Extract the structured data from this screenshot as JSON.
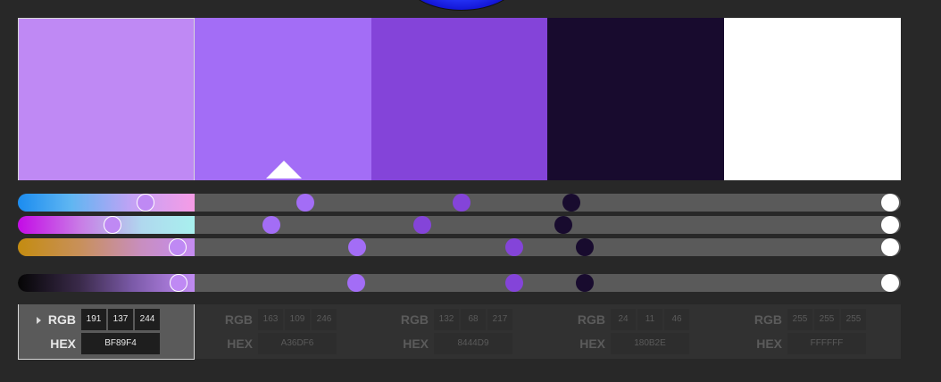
{
  "labels": {
    "rgb": "RGB",
    "hex": "HEX"
  },
  "selected_index": 0,
  "swatches": [
    {
      "hex": "BF89F4",
      "rgb": [
        "191",
        "137",
        "244"
      ],
      "color": "#bf89f4"
    },
    {
      "hex": "A36DF6",
      "rgb": [
        "163",
        "109",
        "246"
      ],
      "color": "#a36df6"
    },
    {
      "hex": "8444D9",
      "rgb": [
        "132",
        "68",
        "217"
      ],
      "color": "#8444d9"
    },
    {
      "hex": "180B2E",
      "rgb": [
        "24",
        "11",
        "46"
      ],
      "color": "#180b2e"
    },
    {
      "hex": "FFFFFF",
      "rgb": [
        "255",
        "255",
        "255"
      ],
      "color": "#ffffff"
    }
  ],
  "colors": {
    "background": "#282828",
    "track": "#5a5a5a",
    "panel": "#313131",
    "selected_panel": "#5a5a5a",
    "selection_border": "#d8d8d8"
  }
}
